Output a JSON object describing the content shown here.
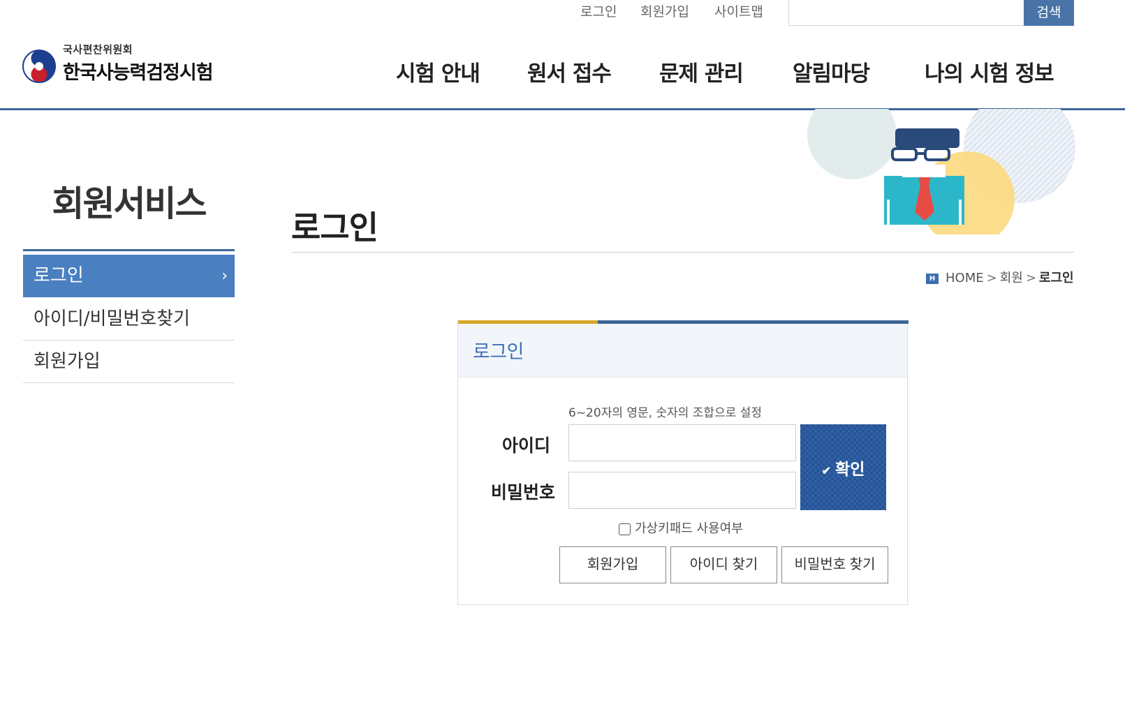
{
  "util_nav": {
    "login": "로그인",
    "signup": "회원가입",
    "sitemap": "사이트맵",
    "search_button": "검색",
    "search_value": ""
  },
  "logo": {
    "org": "국사편찬위원회",
    "title": "한국사능력검정시험"
  },
  "gnb": [
    "시험 안내",
    "원서 접수",
    "문제 관리",
    "알림마당",
    "나의 시험 정보"
  ],
  "sidebar": {
    "title": "회원서비스",
    "items": [
      {
        "label": "로그인",
        "active": true,
        "chevron": "›"
      },
      {
        "label": "아이디/비밀번호찾기",
        "active": false
      },
      {
        "label": "회원가입",
        "active": false
      }
    ]
  },
  "page": {
    "title": "로그인",
    "breadcrumb": {
      "home_badge": "H",
      "home": "HOME",
      "separator": ">",
      "level1": "회원",
      "current": "로그인"
    }
  },
  "login_form": {
    "heading": "로그인",
    "hint": "6~20자의 영문, 숫자의 조합으로 설정",
    "id_label": "아이디",
    "id_value": "",
    "pw_label": "비밀번호",
    "pw_value": "",
    "confirm_check": "✔",
    "confirm_label": "확인",
    "virtual_keypad_label": "가상키패드 사용여부",
    "virtual_keypad_checked": false,
    "buttons": {
      "signup": "회원가입",
      "find_id": "아이디 찾기",
      "find_pw": "비밀번호 찾기"
    }
  },
  "colors": {
    "primary": "#3d6698",
    "side_active": "#4a7fc0",
    "confirm_button": "#24549a",
    "accent_yellow": "#d6a62a",
    "login_heading": "#3e71b4"
  }
}
